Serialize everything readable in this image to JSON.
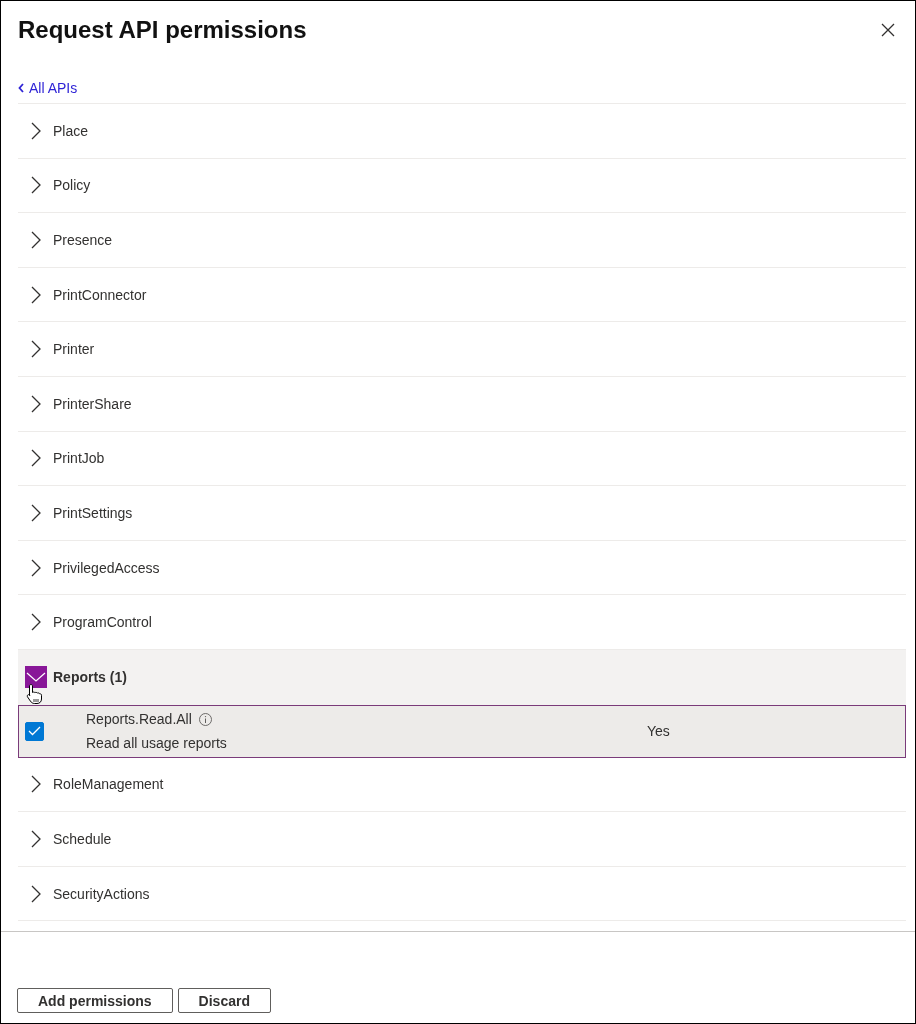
{
  "dialog": {
    "title": "Request API permissions",
    "back_link": "All APIs"
  },
  "api_groups": [
    {
      "name": "Place",
      "expanded": false,
      "hovered": false
    },
    {
      "name": "Policy",
      "expanded": false,
      "hovered": false
    },
    {
      "name": "Presence",
      "expanded": false,
      "hovered": false
    },
    {
      "name": "PrintConnector",
      "expanded": false,
      "hovered": false
    },
    {
      "name": "Printer",
      "expanded": false,
      "hovered": false
    },
    {
      "name": "PrinterShare",
      "expanded": false,
      "hovered": false
    },
    {
      "name": "PrintJob",
      "expanded": false,
      "hovered": false
    },
    {
      "name": "PrintSettings",
      "expanded": false,
      "hovered": false
    },
    {
      "name": "PrivilegedAccess",
      "expanded": false,
      "hovered": false
    },
    {
      "name": "ProgramControl",
      "expanded": false,
      "hovered": false
    },
    {
      "name": "Reports (1)",
      "expanded": true,
      "hovered": true,
      "permissions": [
        {
          "name": "Reports.Read.All",
          "description": "Read all usage reports",
          "checked": true,
          "column_3": "Yes"
        }
      ]
    },
    {
      "name": "RoleManagement",
      "expanded": false,
      "hovered": false
    },
    {
      "name": "Schedule",
      "expanded": false,
      "hovered": false
    },
    {
      "name": "SecurityActions",
      "expanded": false,
      "hovered": false
    }
  ],
  "buttons": [
    {
      "label": "Add permissions"
    },
    {
      "label": "Discard"
    }
  ]
}
